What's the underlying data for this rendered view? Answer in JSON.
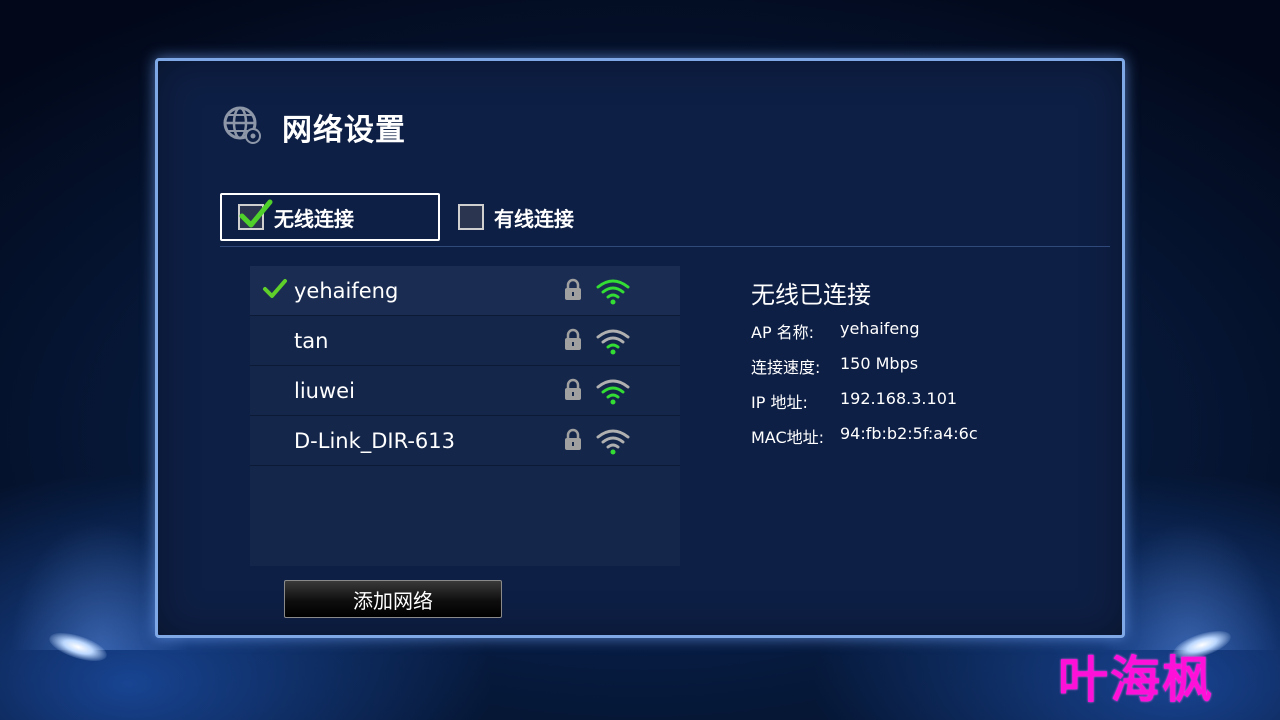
{
  "header": {
    "title": "网络设置",
    "icon": "globe-settings-icon"
  },
  "tabs": [
    {
      "label": "无线连接",
      "checked": true
    },
    {
      "label": "有线连接",
      "checked": false
    }
  ],
  "networks": [
    {
      "ssid": "yehaifeng",
      "connected": true,
      "secured": true,
      "signal_color": "#33dd33"
    },
    {
      "ssid": "tan",
      "connected": false,
      "secured": true,
      "signal_color": "#b0b0b0"
    },
    {
      "ssid": "liuwei",
      "connected": false,
      "secured": true,
      "signal_color": "#33dd33"
    },
    {
      "ssid": "D-Link_DIR-613",
      "connected": false,
      "secured": true,
      "signal_color": "#b0b0b0"
    }
  ],
  "add_button": {
    "label": "添加网络"
  },
  "status": {
    "title": "无线已连接",
    "rows": [
      {
        "key": "AP 名称:",
        "value": "yehaifeng"
      },
      {
        "key": "连接速度:",
        "value": "150 Mbps"
      },
      {
        "key": "IP 地址:",
        "value": "192.168.3.101"
      },
      {
        "key": "MAC地址:",
        "value": "94:fb:b2:5f:a4:6c"
      }
    ]
  },
  "watermark": "叶海枫",
  "colors": {
    "accent_green": "#33dd33",
    "panel_border": "#7fa8e6",
    "watermark": "#ff10d8"
  }
}
